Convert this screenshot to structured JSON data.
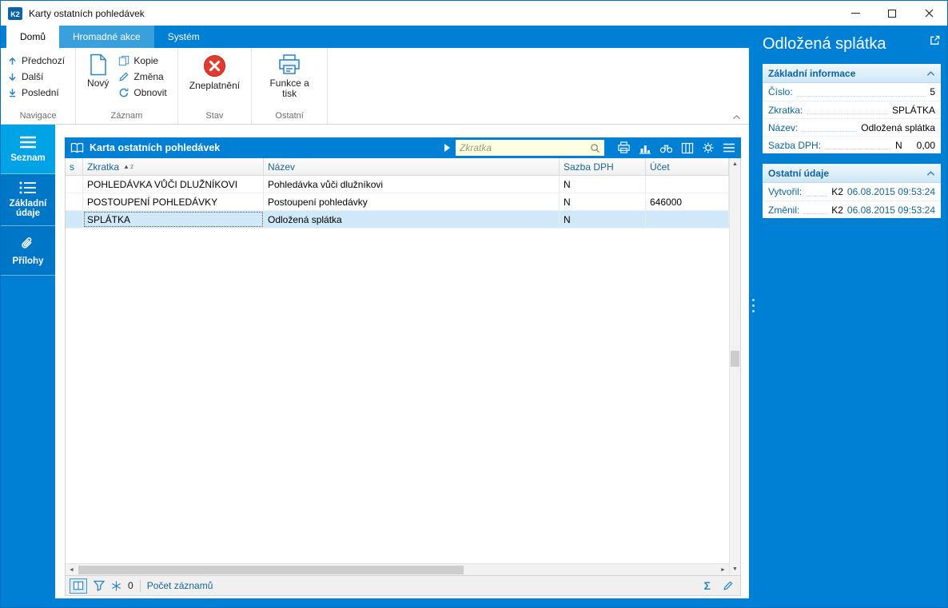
{
  "window": {
    "title": "Karty ostatních pohledávek"
  },
  "tabs": [
    {
      "label": "Domů"
    },
    {
      "label": "Hromadné akce"
    },
    {
      "label": "Systém"
    }
  ],
  "ribbon": {
    "navigace": {
      "label": "Navigace",
      "prev": "Předchozí",
      "next": "Další",
      "last": "Poslední"
    },
    "zaznam": {
      "label": "Záznam",
      "new": "Nový",
      "copy": "Kopie",
      "change": "Změna",
      "refresh": "Obnovit"
    },
    "stav": {
      "label": "Stav",
      "invalidate": "Zneplatnění"
    },
    "ostatni": {
      "label": "Ostatní",
      "functions": "Funkce a tisk"
    }
  },
  "sidebar": [
    {
      "label": "Seznam"
    },
    {
      "label": "Základní údaje"
    },
    {
      "label": "Přílohy"
    }
  ],
  "grid": {
    "title": "Karta ostatních pohledávek",
    "search": {
      "placeholder": "Zkratka"
    },
    "columns": {
      "s": "s",
      "zkratka": "Zkratka",
      "nazev": "Název",
      "sazba_dph": "Sazba DPH",
      "ucet": "Účet"
    },
    "sort": {
      "icon": "▲",
      "order": "2"
    },
    "rows": [
      {
        "zkratka": "POHLEDÁVKA VŮČI DLUŽNÍKOVI",
        "nazev": "Pohledávka vůči dlužníkovi",
        "sazba_dph": "N",
        "ucet": ""
      },
      {
        "zkratka": "POSTOUPENÍ POHLEDÁVKY",
        "nazev": "Postoupení pohledávky",
        "sazba_dph": "N",
        "ucet": "646000"
      },
      {
        "zkratka": "SPLÁTKA",
        "nazev": "Odložená splátka",
        "sazba_dph": "N",
        "ucet": ""
      }
    ],
    "status": {
      "filter_count": "0",
      "records_label": "Počet záznamů",
      "sum": "Σ"
    }
  },
  "detail": {
    "title": "Odložená splátka",
    "basic": {
      "title": "Základní informace",
      "rows": [
        {
          "label": "Číslo:",
          "value": "5"
        },
        {
          "label": "Zkratka:",
          "value": "SPLÁTKA"
        },
        {
          "label": "Název:",
          "value": "Odložená splátka"
        },
        {
          "label": "Sazba DPH:",
          "value": "N",
          "value2": "0,00"
        }
      ]
    },
    "other": {
      "title": "Ostatní údaje",
      "rows": [
        {
          "label": "Vytvořil:",
          "value": "K2",
          "value2": "06.08.2015 09:53:24"
        },
        {
          "label": "Změnil:",
          "value": "K2",
          "value2": "06.08.2015 09:53:24"
        }
      ]
    }
  },
  "colors": {
    "primary_blue": "#0080d4",
    "sidebar_active": "#00a3e6",
    "label_blue": "#0b62a4",
    "header_text_blue": "#15659c",
    "selected_row": "#cfe9f9",
    "search_bg": "#ffffe1",
    "invalid_red": "#e23a2e"
  }
}
